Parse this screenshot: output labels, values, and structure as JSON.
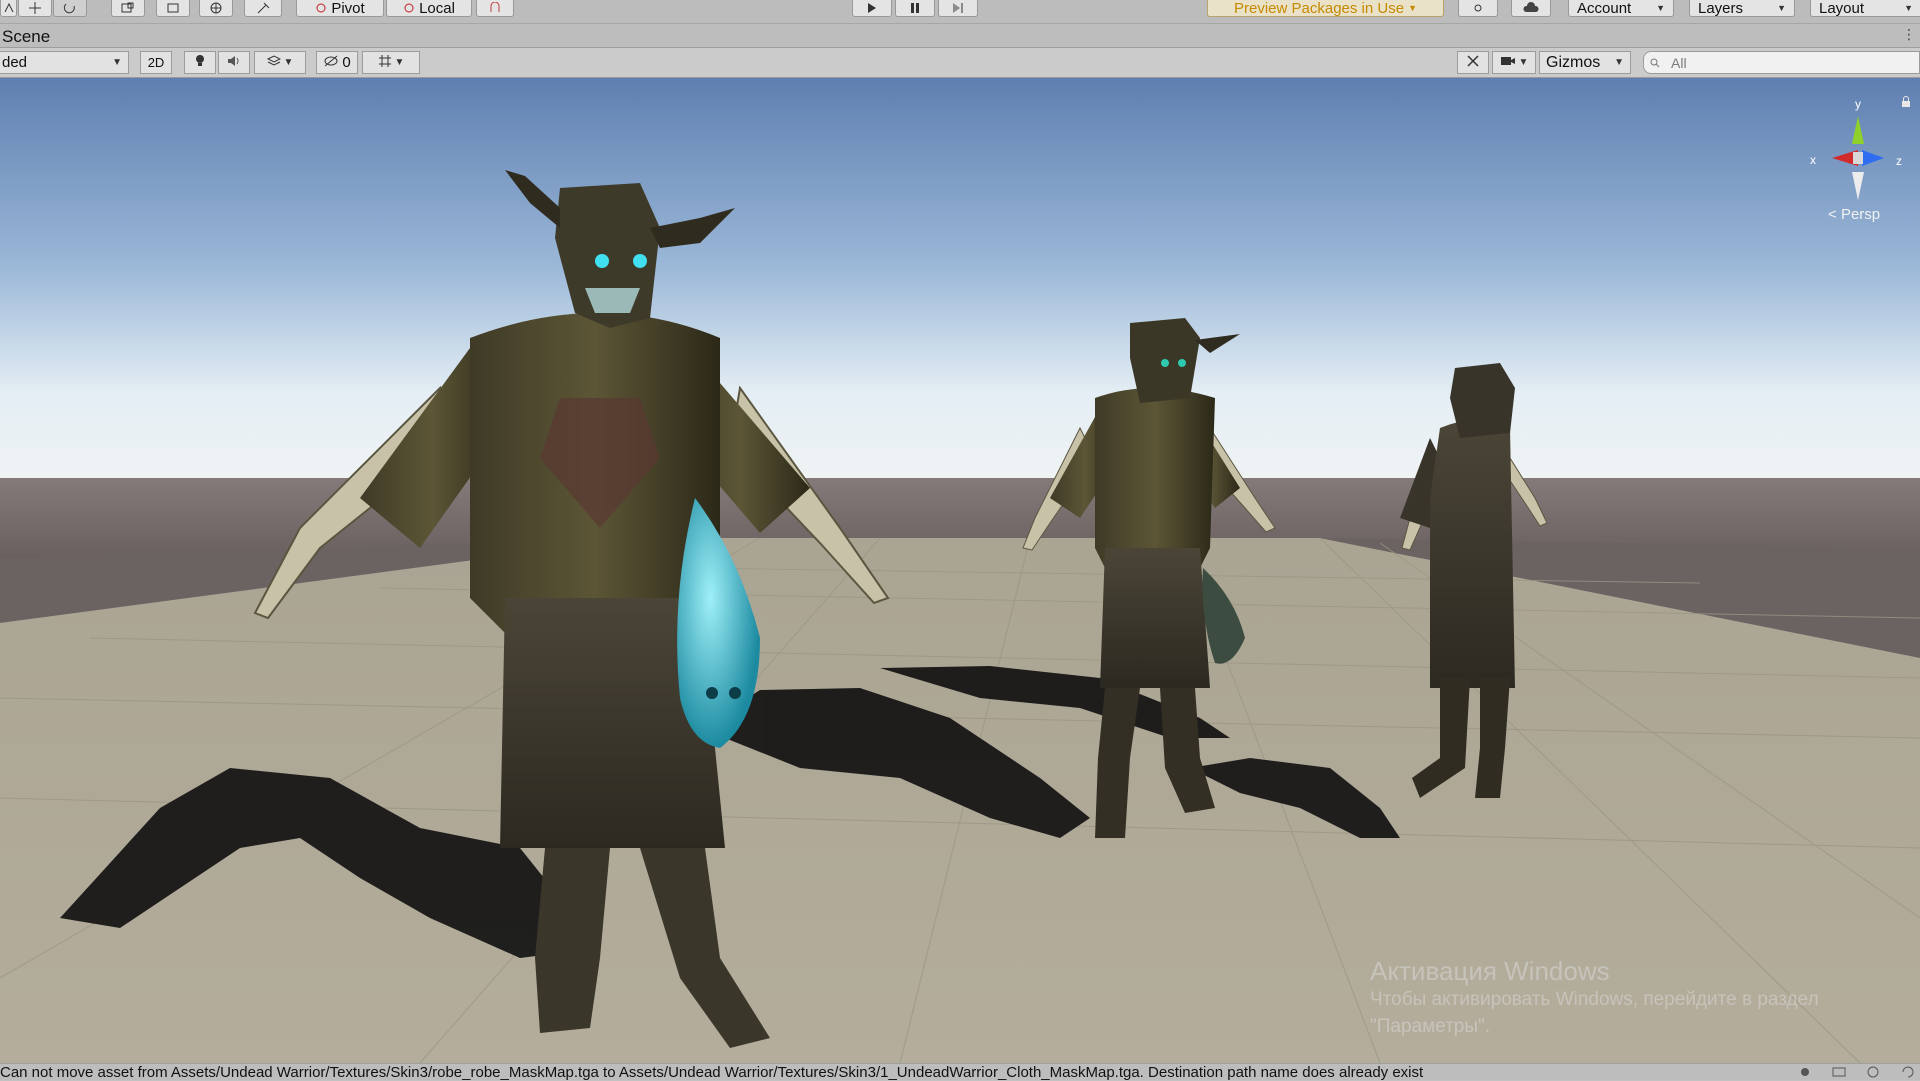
{
  "toolbar": {
    "pivot_label": "Pivot",
    "local_label": "Local",
    "preview_packages_label": "Preview Packages in Use",
    "account_label": "Account",
    "layers_label": "Layers",
    "layout_label": "Layout"
  },
  "scene_tab": {
    "title": "Scene"
  },
  "scene_toolbar": {
    "shading_mode": "ded",
    "mode_2d": "2D",
    "hidden_count": "0",
    "gizmos_label": "Gizmos",
    "search_placeholder": "All"
  },
  "viewport": {
    "gizmo": {
      "x_label": "x",
      "y_label": "y",
      "z_label": "z",
      "projection": "Persp"
    },
    "watermark": {
      "title": "Активация Windows",
      "line1": "Чтобы активировать Windows, перейдите в раздел",
      "line2": "\"Параметры\"."
    }
  },
  "status_bar": {
    "message": "Can not move asset from Assets/Undead Warrior/Textures/Skin3/robe_robe_MaskMap.tga to Assets/Undead Warrior/Textures/Skin3/1_UndeadWarrior_Cloth_MaskMap.tga. Destination path name does already exist"
  },
  "colors": {
    "toolbar_bg": "#bcbcbc",
    "preview_packages_text": "#c58a00",
    "gizmo_x": "#d22b2b",
    "gizmo_y": "#8fd12a",
    "gizmo_z": "#2f6cf0"
  },
  "icons": [
    "view-tool-icon",
    "move-tool-icon",
    "rotate-tool-icon",
    "scale-tool-icon",
    "rect-tool-icon",
    "transform-tool-icon",
    "custom-tool-icon",
    "pivot-icon",
    "local-icon",
    "snap-icon",
    "play-icon",
    "pause-icon",
    "step-icon",
    "collab-icon",
    "cloud-icon",
    "lighting-icon",
    "audio-icon",
    "effects-icon",
    "hidden-objects-icon",
    "grid-icon",
    "tools-icon",
    "camera-icon",
    "search-icon",
    "lock-icon"
  ]
}
